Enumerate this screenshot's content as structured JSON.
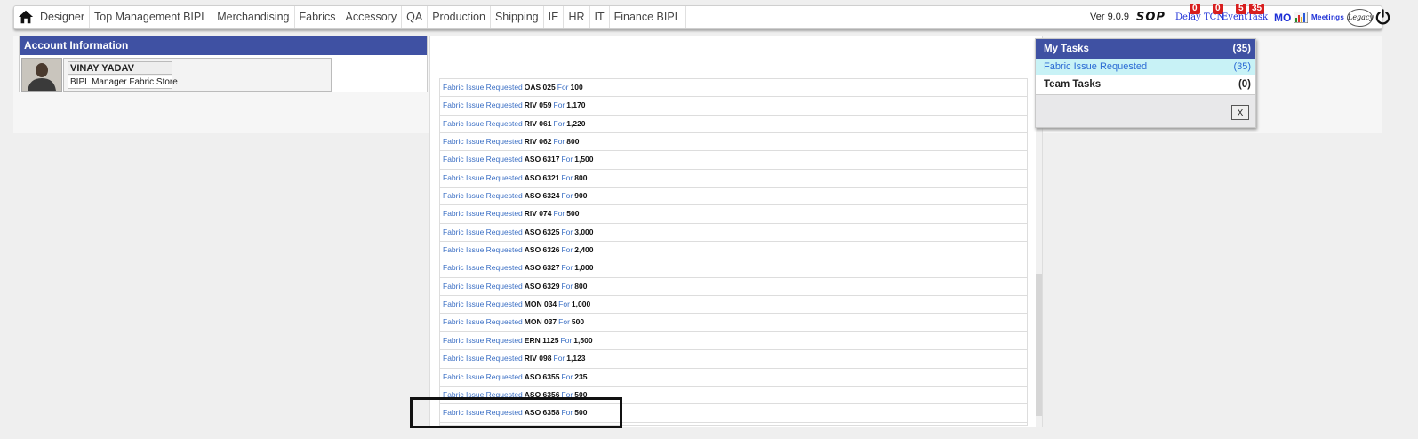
{
  "nav": {
    "home_icon": "home-icon",
    "items": [
      "Designer",
      "Top Management BIPL",
      "Merchandising",
      "Fabrics",
      "Accessory",
      "QA",
      "Production",
      "Shipping",
      "IE",
      "HR",
      "IT",
      "Finance BIPL"
    ],
    "version": "Ver 9.0.9",
    "sop": "SOP",
    "delay": {
      "label": "Delay",
      "count": "0"
    },
    "tcn": {
      "label": "TCN",
      "count": "0"
    },
    "event": {
      "label": "Event",
      "count": "5"
    },
    "task": {
      "label": "Task",
      "count": "35"
    },
    "mo": "MO",
    "meetings": "Meetings",
    "legacy": "Legacy"
  },
  "account": {
    "header": "Account Information",
    "name": "VINAY YADAV",
    "role": "BIPL Manager Fabric Store"
  },
  "tasks": {
    "my_tasks_label": "My Tasks",
    "my_tasks_count": "(35)",
    "item_label": "Fabric Issue Requested",
    "item_count": "(35)",
    "team_tasks_label": "Team Tasks",
    "team_tasks_count": "(0)",
    "close_label": "X"
  },
  "list": {
    "rows": [
      {
        "link": "Fabric Issue Requested",
        "order": "OAS 025",
        "for": "For",
        "qty": "100"
      },
      {
        "link": "Fabric Issue Requested",
        "order": "RIV 059",
        "for": "For",
        "qty": "1,170"
      },
      {
        "link": "Fabric Issue Requested",
        "order": "RIV 061",
        "for": "For",
        "qty": "1,220"
      },
      {
        "link": "Fabric Issue Requested",
        "order": "RIV 062",
        "for": "For",
        "qty": "800"
      },
      {
        "link": "Fabric Issue Requested",
        "order": "ASO 6317",
        "for": "For",
        "qty": "1,500"
      },
      {
        "link": "Fabric Issue Requested",
        "order": "ASO 6321",
        "for": "For",
        "qty": "800"
      },
      {
        "link": "Fabric Issue Requested",
        "order": "ASO 6324",
        "for": "For",
        "qty": "900"
      },
      {
        "link": "Fabric Issue Requested",
        "order": "RIV 074",
        "for": "For",
        "qty": "500"
      },
      {
        "link": "Fabric Issue Requested",
        "order": "ASO 6325",
        "for": "For",
        "qty": "3,000"
      },
      {
        "link": "Fabric Issue Requested",
        "order": "ASO 6326",
        "for": "For",
        "qty": "2,400"
      },
      {
        "link": "Fabric Issue Requested",
        "order": "ASO 6327",
        "for": "For",
        "qty": "1,000"
      },
      {
        "link": "Fabric Issue Requested",
        "order": "ASO 6329",
        "for": "For",
        "qty": "800"
      },
      {
        "link": "Fabric Issue Requested",
        "order": "MON 034",
        "for": "For",
        "qty": "1,000"
      },
      {
        "link": "Fabric Issue Requested",
        "order": "MON 037",
        "for": "For",
        "qty": "500"
      },
      {
        "link": "Fabric Issue Requested",
        "order": "ERN 1125",
        "for": "For",
        "qty": "1,500"
      },
      {
        "link": "Fabric Issue Requested",
        "order": "RIV 098",
        "for": "For",
        "qty": "1,123"
      },
      {
        "link": "Fabric Issue Requested",
        "order": "ASO 6355",
        "for": "For",
        "qty": "235"
      },
      {
        "link": "Fabric Issue Requested",
        "order": "ASO 6356",
        "for": "For",
        "qty": "500"
      },
      {
        "link": "Fabric Issue Requested",
        "order": "ASO 6358",
        "for": "For",
        "qty": "500"
      }
    ]
  },
  "colors": {
    "header_blue": "#3f51a3",
    "link_blue": "#3b6fc4",
    "badge_red": "#d81e1e",
    "highlight_item_bg": "#c8f2f6"
  }
}
